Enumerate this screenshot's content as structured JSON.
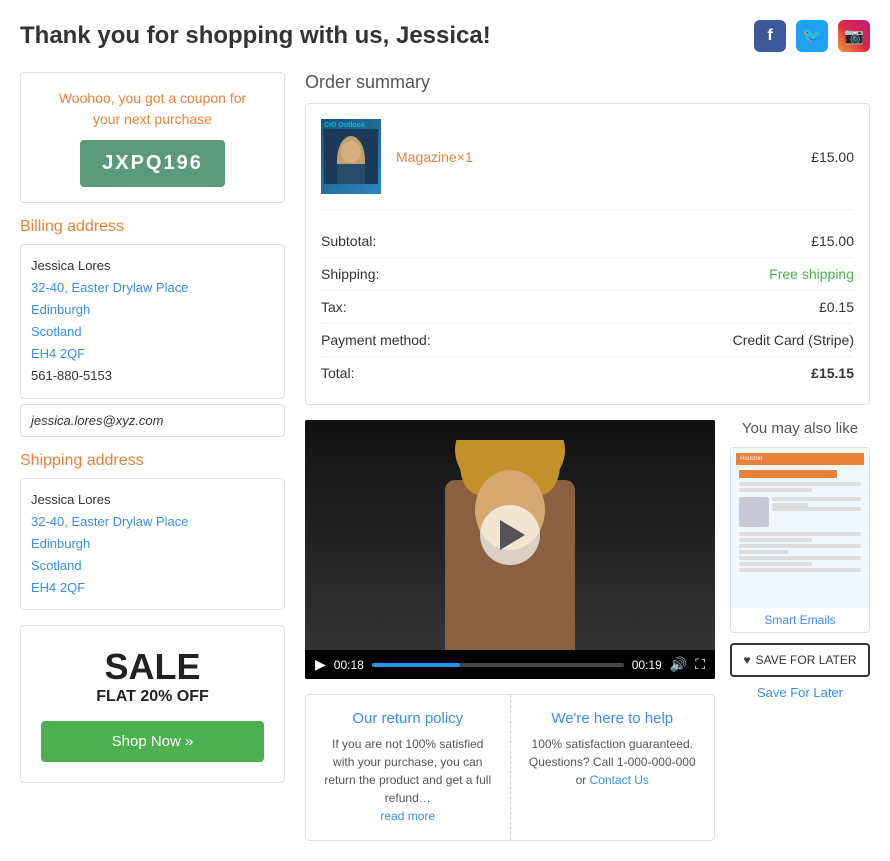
{
  "header": {
    "title": "Thank you for shopping with us, Jessica!",
    "social": {
      "facebook": "f",
      "twitter": "t",
      "instagram": "ig"
    }
  },
  "coupon": {
    "text_line1": "Woohoo, you got a coupon for",
    "text_line2": "your next purchase",
    "code": "JXPQ196"
  },
  "billing": {
    "section_title": "Billing address",
    "name": "Jessica Lores",
    "address_line1": "32-40, Easter Drylaw Place",
    "city": "Edinburgh",
    "region": "Scotland",
    "postcode": "EH4 2QF",
    "phone": "561-880-5153",
    "email": "jessica.lores@xyz.com"
  },
  "shipping": {
    "section_title": "Shipping address",
    "name": "Jessica Lores",
    "address_line1": "32-40, Easter Drylaw Place",
    "city": "Edinburgh",
    "region": "Scotland",
    "postcode": "EH4 2QF"
  },
  "sale": {
    "title": "SALE",
    "subtitle": "FLAT 20% OFF",
    "button_label": "Shop Now »"
  },
  "order_summary": {
    "title": "Order summary",
    "item_name": "Magazine",
    "item_qty": "×1",
    "item_price": "£15.00",
    "subtotal_label": "Subtotal:",
    "subtotal_value": "£15.00",
    "shipping_label": "Shipping:",
    "shipping_value": "Free shipping",
    "tax_label": "Tax:",
    "tax_value": "£0.15",
    "payment_label": "Payment method:",
    "payment_value": "Credit Card (Stripe)",
    "total_label": "Total:",
    "total_value": "£15.15"
  },
  "video": {
    "time_elapsed": "00:18",
    "time_total": "00:19"
  },
  "return_policy": {
    "title": "Our return policy",
    "text": "If you are not 100% satisfied with your purchase, you can return the product and get a full refund…",
    "link": "read more"
  },
  "help": {
    "title": "We're here to help",
    "text": "100% satisfaction guaranteed. Questions? Call 1-000-000-000 or",
    "link": "Contact Us"
  },
  "you_may_like": {
    "title": "You may also like",
    "product_label": "Smart Emails",
    "save_button": "SAVE FOR LATER",
    "save_label": "Save For Later"
  }
}
